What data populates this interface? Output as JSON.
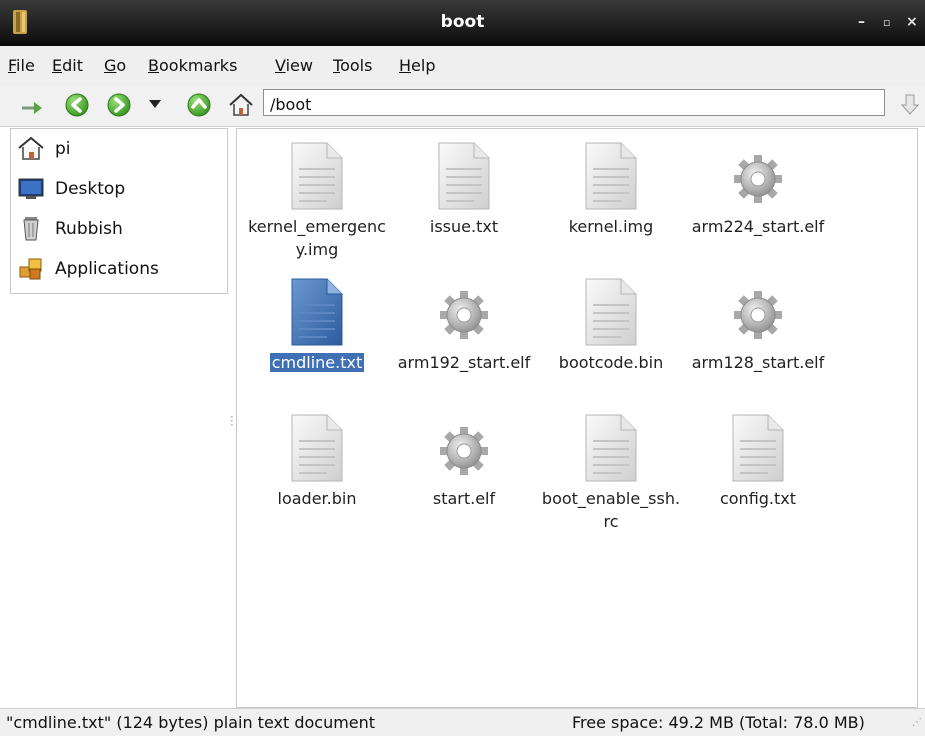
{
  "window": {
    "title": "boot"
  },
  "menu": [
    {
      "label": "File",
      "mnemonic": "F",
      "rest": "ile"
    },
    {
      "label": "Edit",
      "mnemonic": "E",
      "rest": "dit"
    },
    {
      "label": "Go",
      "mnemonic": "G",
      "rest": "o"
    },
    {
      "label": "Bookmarks",
      "mnemonic": "B",
      "rest": "ookmarks"
    },
    {
      "label": "View",
      "mnemonic": "V",
      "rest": "iew"
    },
    {
      "label": "Tools",
      "mnemonic": "T",
      "rest": "ools"
    },
    {
      "label": "Help",
      "mnemonic": "H",
      "rest": "elp"
    }
  ],
  "toolbar": {
    "path": "/boot"
  },
  "sidebar": {
    "items": [
      {
        "label": "pi",
        "icon": "home-icon"
      },
      {
        "label": "Desktop",
        "icon": "desktop-icon"
      },
      {
        "label": "Rubbish",
        "icon": "trash-icon"
      },
      {
        "label": "Applications",
        "icon": "applications-icon"
      }
    ]
  },
  "files": [
    {
      "name": "kernel_emergency.img",
      "icon": "document-icon",
      "selected": false
    },
    {
      "name": "issue.txt",
      "icon": "document-icon",
      "selected": false
    },
    {
      "name": "kernel.img",
      "icon": "document-icon",
      "selected": false
    },
    {
      "name": "arm224_start.elf",
      "icon": "executable-gear-icon",
      "selected": false
    },
    {
      "name": "cmdline.txt",
      "icon": "document-icon",
      "selected": true
    },
    {
      "name": "arm192_start.elf",
      "icon": "executable-gear-icon",
      "selected": false
    },
    {
      "name": "bootcode.bin",
      "icon": "document-icon",
      "selected": false
    },
    {
      "name": "arm128_start.elf",
      "icon": "executable-gear-icon",
      "selected": false
    },
    {
      "name": "loader.bin",
      "icon": "document-icon",
      "selected": false
    },
    {
      "name": "start.elf",
      "icon": "executable-gear-icon",
      "selected": false
    },
    {
      "name": "boot_enable_ssh.rc",
      "icon": "document-icon",
      "selected": false
    },
    {
      "name": "config.txt",
      "icon": "document-icon",
      "selected": false
    }
  ],
  "status": {
    "selection": "\"cmdline.txt\" (124 bytes) plain text document",
    "free_space": "Free space: 49.2 MB (Total: 78.0 MB)"
  },
  "colors": {
    "title_bar": "#1b1b1b",
    "selection_highlight": "#3f6fb4",
    "nav_green": "#4cae2e"
  }
}
